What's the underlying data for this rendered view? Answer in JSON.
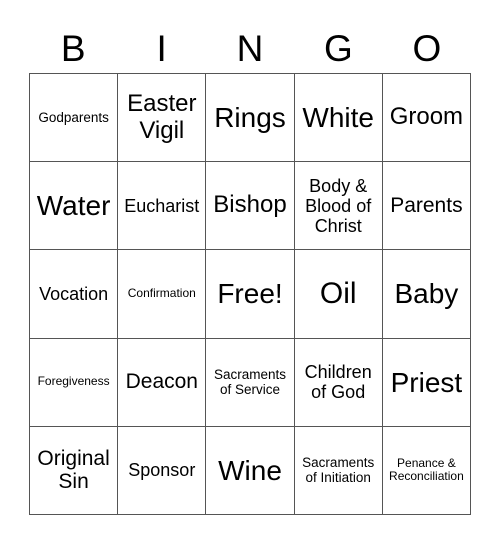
{
  "header": {
    "letters": [
      "B",
      "I",
      "N",
      "G",
      "O"
    ]
  },
  "board": {
    "rows": [
      [
        "Godparents",
        "Easter Vigil",
        "Rings",
        "White",
        "Groom"
      ],
      [
        "Water",
        "Eucharist",
        "Bishop",
        "Body & Blood of Christ",
        "Parents"
      ],
      [
        "Vocation",
        "Confirmation",
        "Free!",
        "Oil",
        "Baby"
      ],
      [
        "Foregiveness",
        "Deacon",
        "Sacraments of Service",
        "Children of God",
        "Priest"
      ],
      [
        "Original Sin",
        "Sponsor",
        "Wine",
        "Sacraments of Initiation",
        "Penance & Reconciliation"
      ]
    ],
    "free_space": "Free!"
  },
  "colors": {
    "grid_line": "#555555",
    "text": "#000000",
    "background": "#ffffff"
  }
}
